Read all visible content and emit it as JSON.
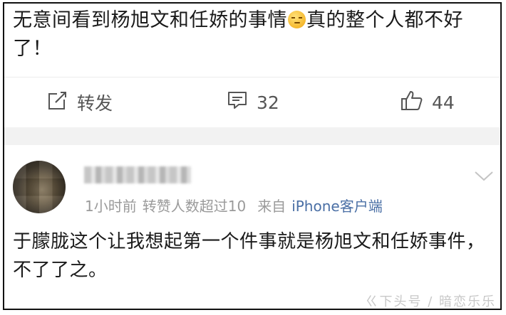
{
  "post": {
    "text_before_emoji": "无意间看到杨旭文和任娇的事情",
    "emoji_name": "doubt-face-emoji",
    "text_after_emoji": "真的整个人都不好了！"
  },
  "actions": {
    "repost_label": "转发",
    "comment_count": "32",
    "like_count": "44"
  },
  "comment": {
    "username": "",
    "time": "1小时前",
    "likes_note": "转赞人数超过10",
    "source_prefix": "来自",
    "source_name": "iPhone客户端",
    "text": "于朦胧这个让我想起第一个件事就是杨旭文和任娇事件，不了了之。"
  },
  "watermark": "ㄍ下头号 / 暗恋乐乐",
  "colors": {
    "text": "#1a1a1a",
    "muted": "#9a9a9a",
    "link": "#4a6fa5",
    "band": "#f2f2f2",
    "border": "#111111"
  },
  "icons": {
    "repost": "edit-share-icon",
    "comment": "comment-bubble-icon",
    "like": "thumbs-up-icon",
    "expand": "chevron-down-icon"
  }
}
